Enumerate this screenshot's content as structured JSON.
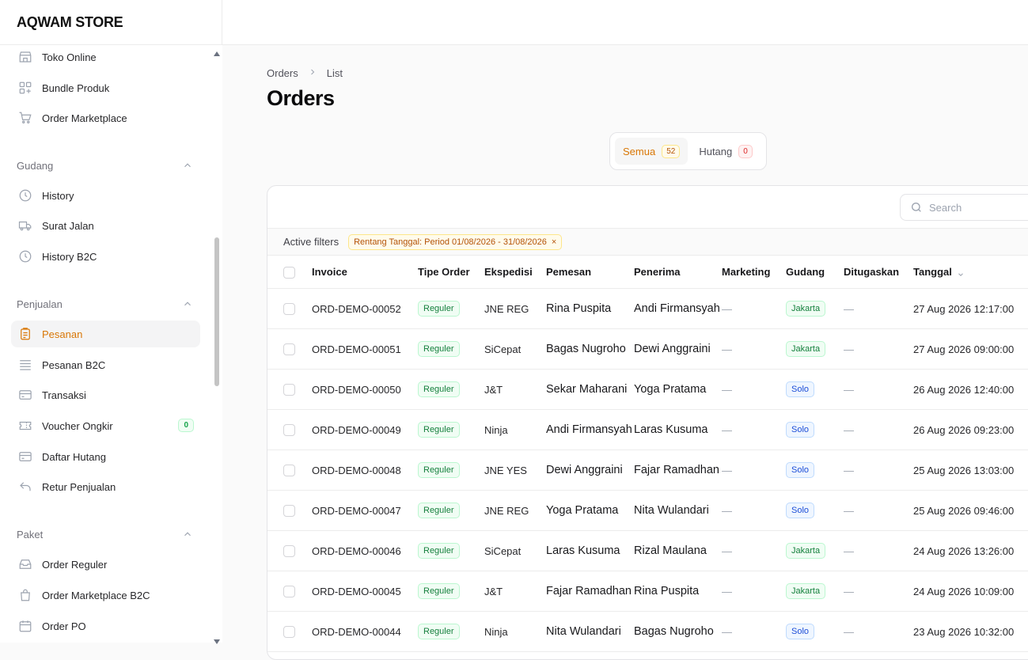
{
  "brand": "AQWAM STORE",
  "sidebar": {
    "items_top": [
      {
        "label": "Toko Online",
        "icon": "store-icon"
      },
      {
        "label": "Bundle Produk",
        "icon": "grid-plus-icon"
      },
      {
        "label": "Order Marketplace",
        "icon": "cart-icon"
      }
    ],
    "group_gudang": "Gudang",
    "items_gudang": [
      {
        "label": "History",
        "icon": "clock-icon"
      },
      {
        "label": "Surat Jalan",
        "icon": "truck-icon"
      },
      {
        "label": "History B2C",
        "icon": "clock-icon"
      }
    ],
    "group_penjualan": "Penjualan",
    "items_penjualan": [
      {
        "label": "Pesanan",
        "icon": "clipboard-icon"
      },
      {
        "label": "Pesanan B2C",
        "icon": "list-icon"
      },
      {
        "label": "Transaksi",
        "icon": "card-icon"
      },
      {
        "label": "Voucher Ongkir",
        "icon": "ticket-icon",
        "badge": "0"
      },
      {
        "label": "Daftar Hutang",
        "icon": "card-icon"
      },
      {
        "label": "Retur Penjualan",
        "icon": "return-icon"
      }
    ],
    "group_paket": "Paket",
    "items_paket": [
      {
        "label": "Order Reguler",
        "icon": "inbox-icon"
      },
      {
        "label": "Order Marketplace B2C",
        "icon": "bag-icon"
      },
      {
        "label": "Order PO",
        "icon": "calendar-icon"
      }
    ]
  },
  "breadcrumb": {
    "root": "Orders",
    "current": "List"
  },
  "page_title": "Orders",
  "tabs": [
    {
      "label": "Semua",
      "count": "52"
    },
    {
      "label": "Hutang",
      "count": "0"
    }
  ],
  "search": {
    "placeholder": "Search"
  },
  "filters": {
    "label": "Active filters",
    "chip": "Rentang Tanggal: Period 01/08/2026 - 31/08/2026"
  },
  "table": {
    "columns": [
      "Invoice",
      "Tipe Order",
      "Ekspedisi",
      "Pemesan",
      "Penerima",
      "Marketing",
      "Gudang",
      "Ditugaskan",
      "Tanggal"
    ],
    "rows": [
      {
        "invoice": "ORD-DEMO-00052",
        "tipe": "Reguler",
        "ekspedisi": "JNE REG",
        "pemesan": "Rina Puspita",
        "penerima": "Andi Firmansyah",
        "marketing": "—",
        "gudang": "Jakarta",
        "ditugaskan": "—",
        "tanggal": "27 Aug 2026 12:17:00"
      },
      {
        "invoice": "ORD-DEMO-00051",
        "tipe": "Reguler",
        "ekspedisi": "SiCepat",
        "pemesan": "Bagas Nugroho",
        "penerima": "Dewi Anggraini",
        "marketing": "—",
        "gudang": "Jakarta",
        "ditugaskan": "—",
        "tanggal": "27 Aug 2026 09:00:00"
      },
      {
        "invoice": "ORD-DEMO-00050",
        "tipe": "Reguler",
        "ekspedisi": "J&T",
        "pemesan": "Sekar Maharani",
        "penerima": "Yoga Pratama",
        "marketing": "—",
        "gudang": "Solo",
        "ditugaskan": "—",
        "tanggal": "26 Aug 2026 12:40:00"
      },
      {
        "invoice": "ORD-DEMO-00049",
        "tipe": "Reguler",
        "ekspedisi": "Ninja",
        "pemesan": "Andi Firmansyah",
        "penerima": "Laras Kusuma",
        "marketing": "—",
        "gudang": "Solo",
        "ditugaskan": "—",
        "tanggal": "26 Aug 2026 09:23:00"
      },
      {
        "invoice": "ORD-DEMO-00048",
        "tipe": "Reguler",
        "ekspedisi": "JNE YES",
        "pemesan": "Dewi Anggraini",
        "penerima": "Fajar Ramadhan",
        "marketing": "—",
        "gudang": "Solo",
        "ditugaskan": "—",
        "tanggal": "25 Aug 2026 13:03:00"
      },
      {
        "invoice": "ORD-DEMO-00047",
        "tipe": "Reguler",
        "ekspedisi": "JNE REG",
        "pemesan": "Yoga Pratama",
        "penerima": "Nita Wulandari",
        "marketing": "—",
        "gudang": "Solo",
        "ditugaskan": "—",
        "tanggal": "25 Aug 2026 09:46:00"
      },
      {
        "invoice": "ORD-DEMO-00046",
        "tipe": "Reguler",
        "ekspedisi": "SiCepat",
        "pemesan": "Laras Kusuma",
        "penerima": "Rizal Maulana",
        "marketing": "—",
        "gudang": "Jakarta",
        "ditugaskan": "—",
        "tanggal": "24 Aug 2026 13:26:00"
      },
      {
        "invoice": "ORD-DEMO-00045",
        "tipe": "Reguler",
        "ekspedisi": "J&T",
        "pemesan": "Fajar Ramadhan",
        "penerima": "Rina Puspita",
        "marketing": "—",
        "gudang": "Jakarta",
        "ditugaskan": "—",
        "tanggal": "24 Aug 2026 10:09:00"
      },
      {
        "invoice": "ORD-DEMO-00044",
        "tipe": "Reguler",
        "ekspedisi": "Ninja",
        "pemesan": "Nita Wulandari",
        "penerima": "Bagas Nugroho",
        "marketing": "—",
        "gudang": "Solo",
        "ditugaskan": "—",
        "tanggal": "23 Aug 2026 10:32:00"
      }
    ]
  }
}
